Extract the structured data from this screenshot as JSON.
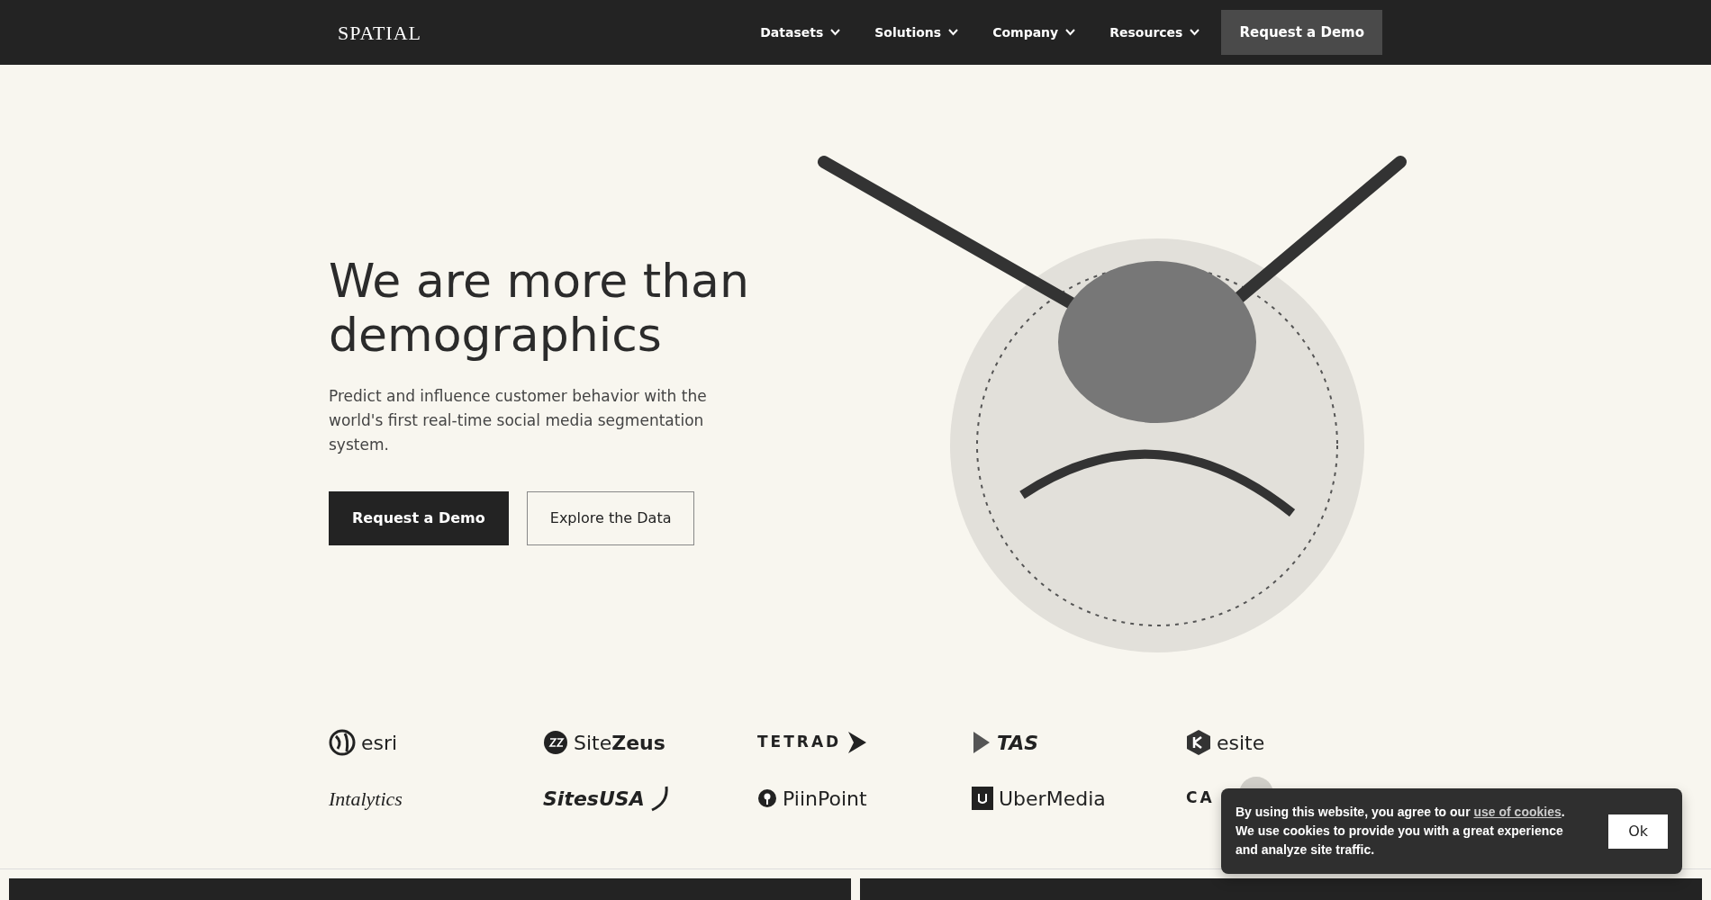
{
  "navbar": {
    "logo": "SPATIAL",
    "items": [
      {
        "label": "Datasets",
        "dropdown": true
      },
      {
        "label": "Solutions",
        "dropdown": true
      },
      {
        "label": "Company",
        "dropdown": true
      },
      {
        "label": "Resources",
        "dropdown": true
      }
    ],
    "cta": "Request a Demo"
  },
  "hero": {
    "title": "We are more than demographics",
    "text": "Predict and influence customer behavior with the world's first real-time social media segmentation system.",
    "buttons": [
      {
        "label": "Request a Demo",
        "kind": "primary"
      },
      {
        "label": "Explore the Data",
        "kind": "outline"
      }
    ]
  },
  "partners": [
    {
      "name": "esri",
      "kind": "globe"
    },
    {
      "name": "Site**Zeus**",
      "kind": "sz"
    },
    {
      "name": "TETRAD",
      "kind": "play-after"
    },
    {
      "name": "TAS",
      "kind": "play-before"
    },
    {
      "name": "esite",
      "kind": "hexagon"
    },
    {
      "name": "Intalytics",
      "kind": "plain"
    },
    {
      "name": "SitesUSA",
      "kind": "swoosh"
    },
    {
      "name": "PiinPoint",
      "kind": "pin"
    },
    {
      "name": "UberMedia",
      "kind": "square"
    },
    {
      "name": "CA",
      "kind": "covered"
    }
  ],
  "cookie_banner": {
    "text_before": "By using this website, you agree to our ",
    "link": "use of cookies",
    "text_after": ". We use cookies to provide you with a great experience and analyze site traffic.",
    "button": "Ok"
  }
}
